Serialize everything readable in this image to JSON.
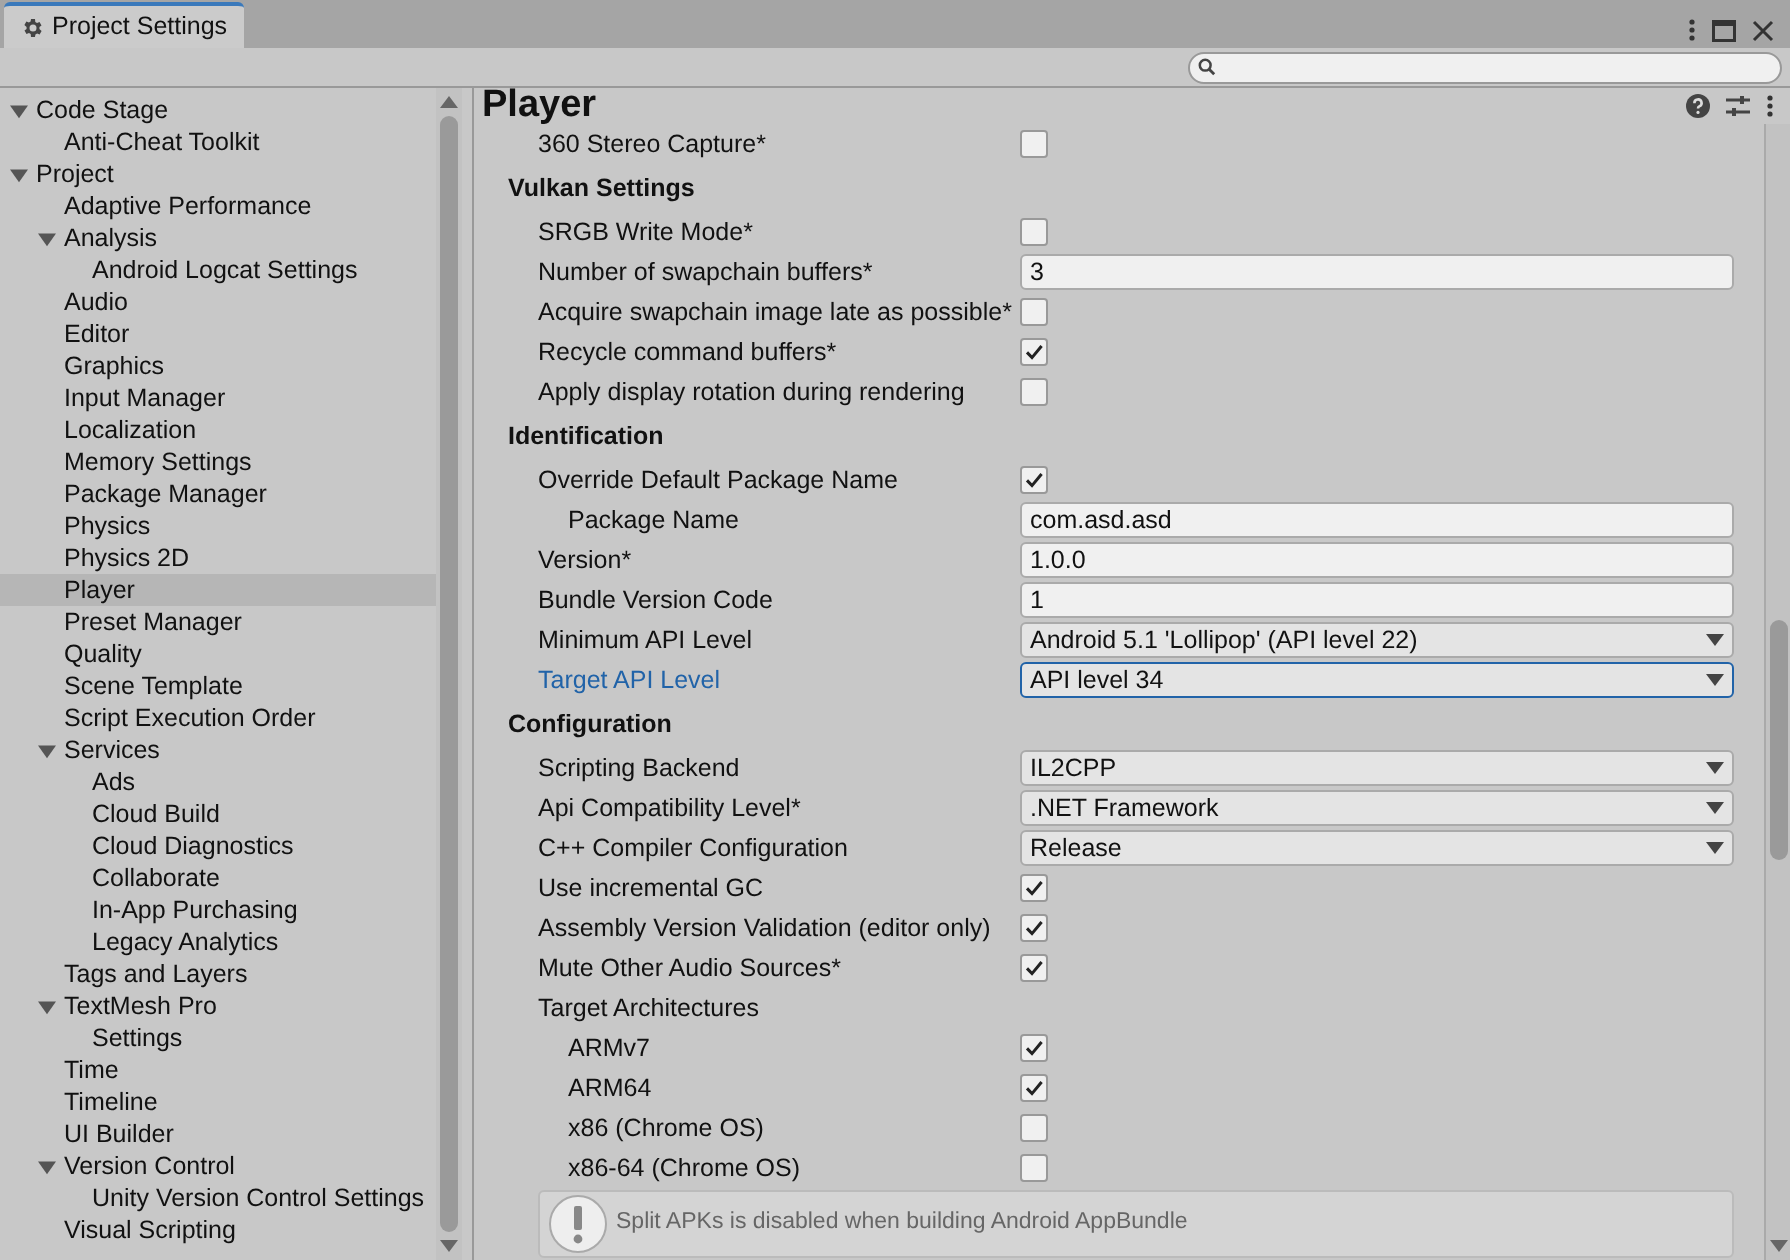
{
  "window": {
    "title": "Project Settings"
  },
  "sidebar": {
    "items": [
      {
        "label": "Code Stage",
        "expanded": true,
        "selected": false,
        "children": [
          {
            "label": "Anti-Cheat Toolkit",
            "selected": false
          }
        ]
      },
      {
        "label": "Project",
        "expanded": true,
        "selected": false,
        "children": [
          {
            "label": "Adaptive Performance",
            "selected": false
          },
          {
            "label": "Analysis",
            "expanded": true,
            "selected": false,
            "children": [
              {
                "label": "Android Logcat Settings",
                "selected": false
              }
            ]
          },
          {
            "label": "Audio",
            "selected": false
          },
          {
            "label": "Editor",
            "selected": false
          },
          {
            "label": "Graphics",
            "selected": false
          },
          {
            "label": "Input Manager",
            "selected": false
          },
          {
            "label": "Localization",
            "selected": false
          },
          {
            "label": "Memory Settings",
            "selected": false
          },
          {
            "label": "Package Manager",
            "selected": false
          },
          {
            "label": "Physics",
            "selected": false
          },
          {
            "label": "Physics 2D",
            "selected": false
          },
          {
            "label": "Player",
            "selected": true
          },
          {
            "label": "Preset Manager",
            "selected": false
          },
          {
            "label": "Quality",
            "selected": false
          },
          {
            "label": "Scene Template",
            "selected": false
          },
          {
            "label": "Script Execution Order",
            "selected": false
          },
          {
            "label": "Services",
            "expanded": true,
            "selected": false,
            "children": [
              {
                "label": "Ads",
                "selected": false
              },
              {
                "label": "Cloud Build",
                "selected": false
              },
              {
                "label": "Cloud Diagnostics",
                "selected": false
              },
              {
                "label": "Collaborate",
                "selected": false
              },
              {
                "label": "In-App Purchasing",
                "selected": false
              },
              {
                "label": "Legacy Analytics",
                "selected": false
              }
            ]
          },
          {
            "label": "Tags and Layers",
            "selected": false
          },
          {
            "label": "TextMesh Pro",
            "expanded": true,
            "selected": false,
            "children": [
              {
                "label": "Settings",
                "selected": false
              }
            ]
          },
          {
            "label": "Time",
            "selected": false
          },
          {
            "label": "Timeline",
            "selected": false
          },
          {
            "label": "UI Builder",
            "selected": false
          },
          {
            "label": "Version Control",
            "expanded": true,
            "selected": false,
            "children": [
              {
                "label": "Unity Version Control Settings",
                "selected": false
              }
            ]
          },
          {
            "label": "Visual Scripting",
            "selected": false
          }
        ]
      }
    ]
  },
  "inspector": {
    "title": "Player",
    "rows": [
      {
        "kind": "checkbox",
        "label": "360 Stereo Capture*",
        "checked": false
      },
      {
        "kind": "header",
        "label": "Vulkan Settings"
      },
      {
        "kind": "checkbox",
        "label": "SRGB Write Mode*",
        "checked": false
      },
      {
        "kind": "text",
        "label": "Number of swapchain buffers*",
        "value": "3"
      },
      {
        "kind": "checkbox",
        "label": "Acquire swapchain image late as possible*",
        "checked": false
      },
      {
        "kind": "checkbox",
        "label": "Recycle command buffers*",
        "checked": true
      },
      {
        "kind": "checkbox",
        "label": "Apply display rotation during rendering",
        "checked": false
      },
      {
        "kind": "header",
        "label": "Identification"
      },
      {
        "kind": "checkbox",
        "label": "Override Default Package Name",
        "checked": true,
        "children": [
          {
            "kind": "text",
            "label": "Package Name",
            "value": "com.asd.asd"
          }
        ]
      },
      {
        "kind": "text",
        "label": "Version*",
        "value": "1.0.0"
      },
      {
        "kind": "text",
        "label": "Bundle Version Code",
        "value": "1"
      },
      {
        "kind": "dropdown",
        "label": "Minimum API Level",
        "value": "Android 5.1 'Lollipop' (API level 22)",
        "focused": false
      },
      {
        "kind": "dropdown",
        "label": "Target API Level",
        "value": "API level 34",
        "focused": true
      },
      {
        "kind": "header",
        "label": "Configuration"
      },
      {
        "kind": "dropdown",
        "label": "Scripting Backend",
        "value": "IL2CPP",
        "focused": false
      },
      {
        "kind": "dropdown",
        "label": "Api Compatibility Level*",
        "value": ".NET Framework",
        "focused": false
      },
      {
        "kind": "dropdown",
        "label": "C++ Compiler Configuration",
        "value": "Release",
        "focused": false
      },
      {
        "kind": "checkbox",
        "label": "Use incremental GC",
        "checked": true
      },
      {
        "kind": "checkbox",
        "label": "Assembly Version Validation (editor only)",
        "checked": true
      },
      {
        "kind": "checkbox",
        "label": "Mute Other Audio Sources*",
        "checked": true
      },
      {
        "kind": "label",
        "label": "Target Architectures",
        "children": [
          {
            "kind": "checkbox",
            "label": "ARMv7",
            "checked": true
          },
          {
            "kind": "checkbox",
            "label": "ARM64",
            "checked": true
          },
          {
            "kind": "checkbox",
            "label": "x86 (Chrome OS)",
            "checked": false
          },
          {
            "kind": "checkbox",
            "label": "x86-64 (Chrome OS)",
            "checked": false
          }
        ]
      },
      {
        "kind": "help",
        "label": "Split APKs is disabled when building Android AppBundle"
      }
    ]
  }
}
